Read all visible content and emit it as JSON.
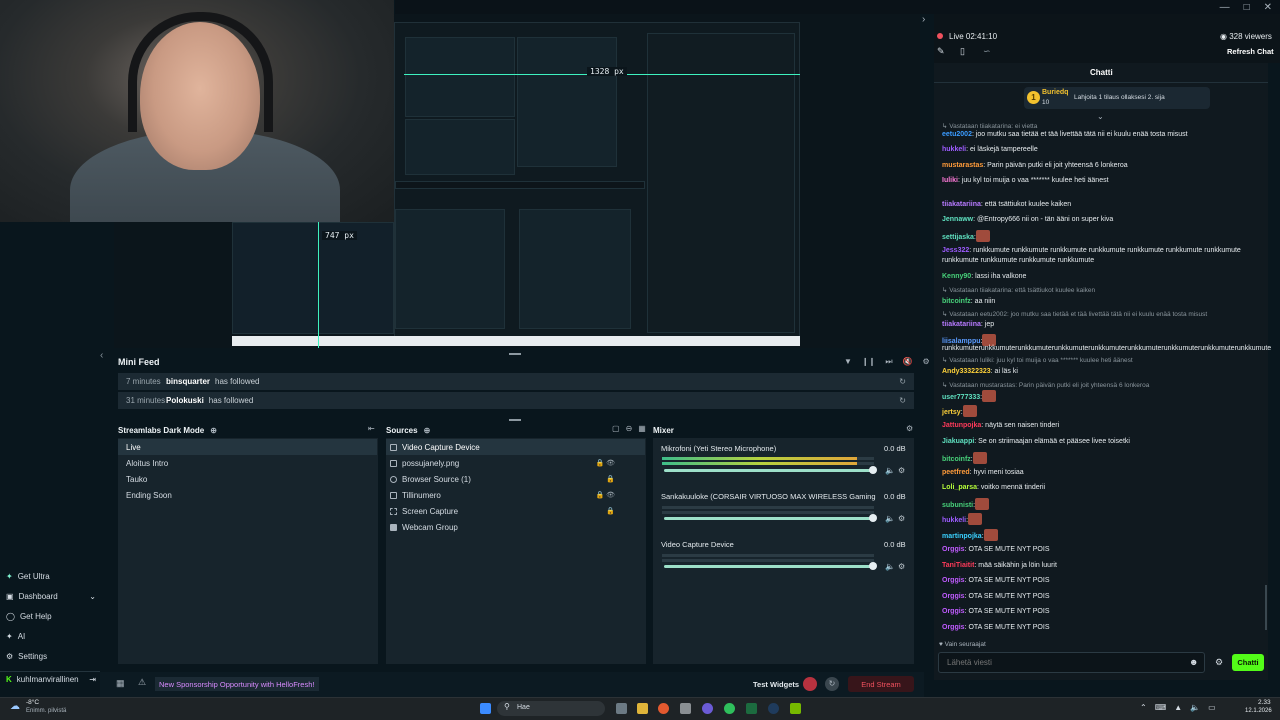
{
  "preview": {
    "measure_width": "1328 px",
    "measure_height": "747 px"
  },
  "mini_feed": {
    "title": "Mini Feed",
    "rows": [
      {
        "time": "7 minutes",
        "user": "binsquarter",
        "action": "has followed"
      },
      {
        "time": "31 minutes",
        "user": "Polokuski",
        "action": "has followed"
      }
    ]
  },
  "scenes": {
    "title": "Streamlabs Dark Mode",
    "items": [
      "Live",
      "Aloitus Intro",
      "Tauko",
      "Ending Soon"
    ]
  },
  "sources": {
    "title": "Sources",
    "items": [
      "Video Capture Device",
      "possujanely.png",
      "Browser Source (1)",
      "Tillinumero",
      "Screen Capture",
      "Webcam Group"
    ]
  },
  "mixer": {
    "title": "Mixer",
    "channels": [
      {
        "name": "Mikrofoni (Yeti Stereo Microphone)",
        "db": "0.0 dB",
        "level": 0.92
      },
      {
        "name": "Sankakuuloke (CORSAIR VIRTUOSO MAX WIRELESS Gaming Recei...",
        "db": "0.0 dB",
        "level": 0.0
      },
      {
        "name": "Video Capture Device",
        "db": "0.0 dB",
        "level": 0.0
      }
    ]
  },
  "left_nav": {
    "items": [
      "Get Ultra",
      "Dashboard",
      "Get Help",
      "AI",
      "Settings"
    ],
    "user": "kuhlmanvirallinen"
  },
  "bottom_bar": {
    "notice": "New Sponsorship Opportunity with HelloFresh!",
    "test_widgets": "Test Widgets",
    "end_stream": "End Stream"
  },
  "live_status": {
    "live": "Live 02:41:10",
    "viewers": "328 viewers",
    "refresh_chat": "Refresh Chat"
  },
  "chat": {
    "title": "Chatti",
    "pinned_user": "Buriedq",
    "pinned_count": "10",
    "pinned_text": "Lahjoita 1 tilaus ollaksesi 2. sija",
    "messages": [
      {
        "reply": "Vastataan tiiakatarina: ei vietta"
      },
      {
        "name": "eetu2002",
        "color": "#3a9bff",
        "text": ": joo mutku saa tietää et tää livettää tätä nii ei kuulu enää tosta misust"
      },
      {
        "name": "hukkeli",
        "color": "#9d5bff",
        "text": ": ei läskejä tampereelle"
      },
      {
        "name": "mustarastas",
        "color": "#ff9b3a",
        "text": ": Parin päivän putki eli joit yhteensä 6 lonkeroa"
      },
      {
        "name": "Iuliki",
        "color": "#ff7ad9",
        "text": ": juu kyl toi muija o vaa ******* kuulee heti äänest"
      },
      {
        "name": "tiiakatariina",
        "color": "#b77aff",
        "text": ": että tsättiukot kuulee kaiken"
      },
      {
        "name": "Jennaww",
        "color": "#5fe1c0",
        "text": ": @Entropy666 nii on - tän ääni on super kiva"
      },
      {
        "name": "settijaska",
        "color": "#5fe1c0",
        "text": ":"
      },
      {
        "name": "Jess322",
        "color": "#9d5bff",
        "text": ": runkkumute runkkumute runkkumute runkkumute runkkumute runkkumute runkkumute runkkumute runkkumute runkkumute runkkumute"
      },
      {
        "name": "Kenny90",
        "color": "#47d17a",
        "text": ": lassi iha valkone"
      },
      {
        "reply": "Vastataan tiiakatarina: että tsättiukot kuulee kaiken"
      },
      {
        "name": "bitcoinfz",
        "color": "#47d17a",
        "text": ": aa niin"
      },
      {
        "reply": "Vastataan eetu2002: joo mutku saa tietää et tää livettää tätä nii ei kuulu enää tosta misust"
      },
      {
        "name": "tiiakatariina",
        "color": "#b77aff",
        "text": ": jep"
      },
      {
        "name": "liisalamppu",
        "color": "#5a9bff",
        "text": ":"
      },
      {
        "text": "runkkumuterunkkumuterunkkumuterunkkumuterunkkumuterunkkumuterunkkumuterunkkumuterunkkumute"
      },
      {
        "reply": "Vastataan Iuliki: juu kyl toi muija o vaa ******* kuulee heti äänest"
      },
      {
        "name": "Andy33322323",
        "color": "#ffd23a",
        "text": ": ai läs ki"
      },
      {
        "reply": "Vastataan mustarastas: Parin päivän putki eli joit yhteensä 6 lonkeroa"
      },
      {
        "name": "user777333",
        "color": "#5fe1c0",
        "text": ":"
      },
      {
        "name": "jertsy",
        "color": "#ffd23a",
        "text": ":"
      },
      {
        "name": "Jattunpojka",
        "color": "#ff3a5a",
        "text": ": näytä sen naisen tinderi"
      },
      {
        "name": "Jiakuappi",
        "color": "#5fe1c0",
        "text": ": Se on striimaajan elämää et pääsee livee toisetki"
      },
      {
        "name": "bitcoinfz",
        "color": "#47d17a",
        "text": ":"
      },
      {
        "name": "peetfred",
        "color": "#ff9b3a",
        "text": ": hyvi meni tosiaa"
      },
      {
        "name": "Loli_parsa",
        "color": "#b7ff3a",
        "text": ": voitko mennä tinderii"
      },
      {
        "name": "subunisti",
        "color": "#47d17a",
        "text": ":"
      },
      {
        "name": "hukkeli",
        "color": "#9d5bff",
        "text": ":"
      },
      {
        "name": "martinpojka",
        "color": "#3ad1ff",
        "text": ":"
      },
      {
        "name": "Orggis",
        "color": "#c05bff",
        "text": ": OTA SE MUTE NYT POIS"
      },
      {
        "name": "TaniTiaitit",
        "color": "#ff3a5a",
        "text": ": mää säikähin ja löin luurit"
      },
      {
        "name": "Orggis",
        "color": "#c05bff",
        "text": ": OTA SE MUTE NYT POIS"
      },
      {
        "name": "Orggis",
        "color": "#c05bff",
        "text": ": OTA SE MUTE NYT POIS"
      },
      {
        "name": "Orggis",
        "color": "#c05bff",
        "text": ": OTA SE MUTE NYT POIS"
      },
      {
        "name": "Orggis",
        "color": "#c05bff",
        "text": ": OTA SE MUTE NYT POIS"
      }
    ],
    "followers_only": "Vain seuraajat",
    "input_placeholder": "Lähetä viesti",
    "send_label": "Chatti"
  },
  "taskbar": {
    "weather_temp": "-8°C",
    "weather_desc": "Enimm. pilvistä",
    "search_placeholder": "Hae",
    "time": "2.33",
    "date": "12.1.2026"
  },
  "colors": {
    "accent": "#80f5d2",
    "live_red": "#f0515e",
    "send_green": "#53fc18"
  }
}
